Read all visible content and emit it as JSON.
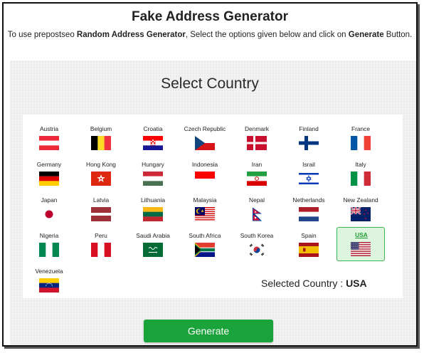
{
  "header": {
    "title": "Fake Address Generator",
    "intro_prefix": "To use prepostseo ",
    "intro_bold1": "Random Address Generator",
    "intro_middle": ", Select the options given below and click on ",
    "intro_bold2": "Generate",
    "intro_suffix": " Button."
  },
  "section_title": "Select Country",
  "countries": [
    {
      "name": "Austria",
      "flag": "austria"
    },
    {
      "name": "Belgium",
      "flag": "belgium"
    },
    {
      "name": "Croatia",
      "flag": "croatia"
    },
    {
      "name": "Czech Republic",
      "flag": "czech"
    },
    {
      "name": "Denmark",
      "flag": "denmark"
    },
    {
      "name": "Finland",
      "flag": "finland"
    },
    {
      "name": "France",
      "flag": "france"
    },
    {
      "name": "Germany",
      "flag": "germany"
    },
    {
      "name": "Hong Kong",
      "flag": "hongkong"
    },
    {
      "name": "Hungary",
      "flag": "hungary"
    },
    {
      "name": "Indonesia",
      "flag": "indonesia"
    },
    {
      "name": "Iran",
      "flag": "iran"
    },
    {
      "name": "Israil",
      "flag": "israel"
    },
    {
      "name": "Italy",
      "flag": "italy"
    },
    {
      "name": "Japan",
      "flag": "japan"
    },
    {
      "name": "Latvia",
      "flag": "latvia"
    },
    {
      "name": "Lithuania",
      "flag": "lithuania"
    },
    {
      "name": "Malaysia",
      "flag": "malaysia"
    },
    {
      "name": "Nepal",
      "flag": "nepal"
    },
    {
      "name": "Netherlands",
      "flag": "netherlands"
    },
    {
      "name": "New Zealand",
      "flag": "newzealand"
    },
    {
      "name": "Nigeria",
      "flag": "nigeria"
    },
    {
      "name": "Peru",
      "flag": "peru"
    },
    {
      "name": "Saudi Arabia",
      "flag": "saudi"
    },
    {
      "name": "South Africa",
      "flag": "southafrica"
    },
    {
      "name": "South Korea",
      "flag": "southkorea"
    },
    {
      "name": "Spain",
      "flag": "spain"
    },
    {
      "name": "USA",
      "flag": "usa",
      "selected": true
    },
    {
      "name": "Venezuela",
      "flag": "venezuela"
    }
  ],
  "selected": {
    "label": "Selected Country : ",
    "value": "USA"
  },
  "generate_button": "Generate",
  "colors": {
    "accent_green": "#1aa33a",
    "selected_bg": "#ddf5de",
    "selected_text": "#1f9d2f"
  }
}
